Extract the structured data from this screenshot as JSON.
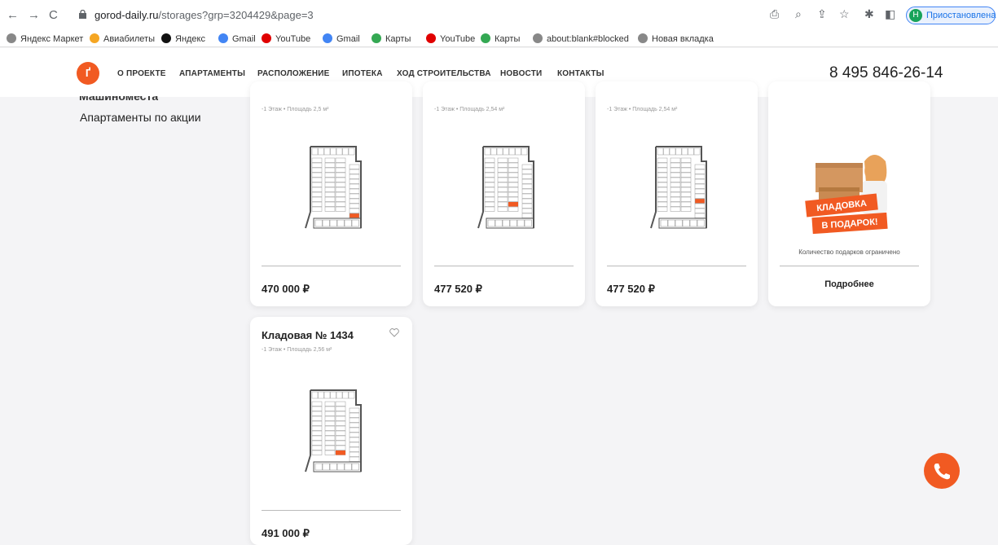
{
  "browser": {
    "url_host": "gorod-daily.ru",
    "url_rest": "/storages?grp=3204429&page=3",
    "profile_initial": "Н",
    "profile_label": "Приостановлена"
  },
  "bookmarks": [
    {
      "label": "Яндекс Маркет",
      "color": "#888888"
    },
    {
      "label": "Авиабилеты",
      "color": "#f5a623"
    },
    {
      "label": "Яндекс",
      "color": "#111111"
    },
    {
      "label": "Gmail",
      "color": "#4285f4"
    },
    {
      "label": "YouTube",
      "color": "#e00000"
    },
    {
      "label": "Gmail",
      "color": "#4285f4"
    },
    {
      "label": "Карты",
      "color": "#34a853"
    },
    {
      "label": "YouTube",
      "color": "#e00000"
    },
    {
      "label": "Карты",
      "color": "#34a853"
    },
    {
      "label": "about:blank#blocked",
      "color": "#888888"
    },
    {
      "label": "Новая вкладка",
      "color": "#888888"
    }
  ],
  "header": {
    "logo": "Ґ",
    "menu": [
      "О ПРОЕКТЕ",
      "АПАРТАМЕНТЫ",
      "РАСПОЛОЖЕНИЕ",
      "ИПОТЕКА",
      "ХОД СТРОИТЕЛЬСТВА",
      "НОВОСТИ",
      "КОНТАКТЫ"
    ],
    "phone": "8 495 846-26-14"
  },
  "sidebar": {
    "cut_item": "Машиноместа",
    "item": "Апартаменты по акции"
  },
  "cards": [
    {
      "meta": "-1 Этаж • Площадь 2,5 м²",
      "price": "470 000 ₽"
    },
    {
      "meta": "-1 Этаж • Площадь 2,54 м²",
      "price": "477 520 ₽"
    },
    {
      "meta": "-1 Этаж • Площадь 2,54 м²",
      "price": "477 520 ₽"
    }
  ],
  "promo": {
    "banner_line1": "КЛАДОВКА",
    "banner_line2": "В ПОДАРОК!",
    "note": "Количество подарков ограничено",
    "more": "Подробнее"
  },
  "card_bottom": {
    "title": "Кладовая № 1434",
    "meta": "-1 Этаж • Площадь 2,56 м²",
    "price": "491 000 ₽"
  },
  "colors": {
    "accent": "#f15a22"
  }
}
